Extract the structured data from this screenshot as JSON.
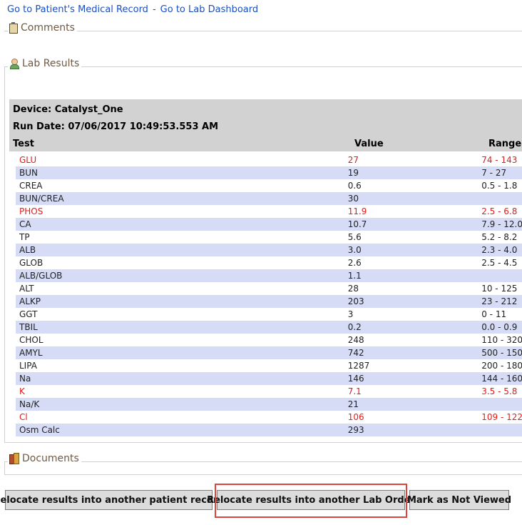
{
  "links": {
    "medical_record": "Go to Patient's Medical Record",
    "separator": "-",
    "lab_dashboard": "Go to Lab Dashboard"
  },
  "sections": {
    "comments": "Comments",
    "lab_results": "Lab Results",
    "documents": "Documents"
  },
  "device": {
    "device_label": "Device: Catalyst_One",
    "run_date_label": "Run Date: 07/06/2017 10:49:53.553 AM"
  },
  "columns": {
    "test": "Test",
    "value": "Value",
    "range": "Range"
  },
  "results": [
    {
      "test": "GLU",
      "value": "27",
      "range": "74 - 143",
      "flag": true
    },
    {
      "test": "BUN",
      "value": "19",
      "range": "7 - 27",
      "flag": false
    },
    {
      "test": "CREA",
      "value": "0.6",
      "range": "0.5 - 1.8",
      "flag": false
    },
    {
      "test": "BUN/CREA",
      "value": "30",
      "range": "",
      "flag": false
    },
    {
      "test": "PHOS",
      "value": "11.9",
      "range": "2.5 - 6.8",
      "flag": true
    },
    {
      "test": "CA",
      "value": "10.7",
      "range": "7.9 - 12.0",
      "flag": false
    },
    {
      "test": "TP",
      "value": "5.6",
      "range": "5.2 - 8.2",
      "flag": false
    },
    {
      "test": "ALB",
      "value": "3.0",
      "range": "2.3 - 4.0",
      "flag": false
    },
    {
      "test": "GLOB",
      "value": "2.6",
      "range": "2.5 - 4.5",
      "flag": false
    },
    {
      "test": "ALB/GLOB",
      "value": "1.1",
      "range": "",
      "flag": false
    },
    {
      "test": "ALT",
      "value": "28",
      "range": "10 - 125",
      "flag": false
    },
    {
      "test": "ALKP",
      "value": "203",
      "range": "23 - 212",
      "flag": false
    },
    {
      "test": "GGT",
      "value": "3",
      "range": "0 - 11",
      "flag": false
    },
    {
      "test": "TBIL",
      "value": "0.2",
      "range": "0.0 - 0.9",
      "flag": false
    },
    {
      "test": "CHOL",
      "value": "248",
      "range": "110 - 320",
      "flag": false
    },
    {
      "test": "AMYL",
      "value": "742",
      "range": "500 - 150",
      "flag": false
    },
    {
      "test": "LIPA",
      "value": "1287",
      "range": "200 - 180",
      "flag": false
    },
    {
      "test": "Na",
      "value": "146",
      "range": "144 - 160",
      "flag": false
    },
    {
      "test": "K",
      "value": "7.1",
      "range": "3.5 - 5.8",
      "flag": true
    },
    {
      "test": "Na/K",
      "value": "21",
      "range": "",
      "flag": false
    },
    {
      "test": "Cl",
      "value": "106",
      "range": "109 - 122",
      "flag": true
    },
    {
      "test": "Osm Calc",
      "value": "293",
      "range": "",
      "flag": false
    }
  ],
  "buttons": {
    "relocate_patient": "Relocate results into another patient record",
    "relocate_lab_order": "Relocate results into another Lab Order",
    "mark_not_viewed": "Mark as Not Viewed"
  },
  "colors": {
    "flag": "#e11d1d",
    "alt_row": "#d7dcf6",
    "header_bg": "#d2d2d2",
    "link": "#1a4fc2",
    "highlight": "#e0413a"
  },
  "icons": {
    "comments": "clipboard-icon",
    "lab_results": "user-icon",
    "documents": "books-icon"
  }
}
